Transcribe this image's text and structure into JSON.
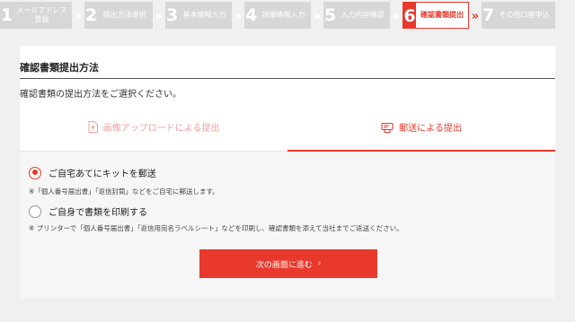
{
  "stepper": {
    "steps": [
      {
        "num": "1",
        "label": "メールアドレス\n登録"
      },
      {
        "num": "2",
        "label": "提出方法選択"
      },
      {
        "num": "3",
        "label": "基本情報入力"
      },
      {
        "num": "4",
        "label": "詳細情報入力"
      },
      {
        "num": "5",
        "label": "入力内容確認"
      },
      {
        "num": "6",
        "label": "確認書類提出"
      },
      {
        "num": "7",
        "label": "その他口座申込"
      }
    ],
    "active_step": 6
  },
  "section": {
    "title": "確認書類提出方法",
    "instruction": "確認書類の提出方法をご選択ください。"
  },
  "tabs": {
    "upload_label": "画像アップロードによる提出",
    "mail_label": "郵送による提出"
  },
  "options": {
    "home_kit_label": "ご自宅あてにキットを郵送",
    "home_kit_note": "※「個人番号届出書」「返信封筒」などをご自宅に郵送します。",
    "self_print_label": "ご自身で書類を印刷する",
    "self_print_note": "※ プリンターで「個人番号届出書」「返信用宛名ラベルシート」などを印刷し、確認書類を添えて当社までご返送ください。"
  },
  "next_button": {
    "label": "次の画面に進む",
    "arrow": "›"
  },
  "colors": {
    "accent": "#e8392c",
    "step_inactive": "#d7d7d7",
    "background": "#f0f0f0"
  }
}
